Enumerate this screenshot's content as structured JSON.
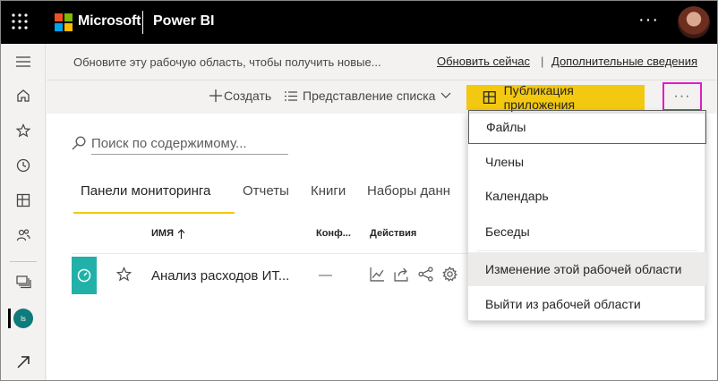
{
  "topbar": {
    "brand": "Microsoft",
    "product": "Power BI",
    "more": "···"
  },
  "notice": {
    "text": "Обновите эту рабочую область, чтобы получить новые...",
    "update_link": "Обновить сейчас",
    "separator": "|",
    "more_link": "Дополнительные сведения"
  },
  "toolbar": {
    "create": "Создать",
    "view": "Представление списка",
    "publish": "Публикация приложения",
    "more": "···"
  },
  "search": {
    "placeholder": "Поиск по содержимому..."
  },
  "tabs": [
    "Панели мониторинга",
    "Отчеты",
    "Книги",
    "Наборы данн"
  ],
  "table": {
    "headers": {
      "name": "ИМЯ",
      "conf": "Конф...",
      "actions": "Действия"
    },
    "rows": [
      {
        "name": "Анализ расходов ИТ...",
        "conf": "—"
      }
    ]
  },
  "workspace": {
    "initials": "ls"
  },
  "menu": {
    "items": [
      "Файлы",
      "Члены",
      "Календарь",
      "Беседы",
      "Изменение этой рабочей области",
      "Выйти из рабочей области"
    ]
  },
  "colors": {
    "accent": "#f2c811",
    "highlight": "#e11bc9",
    "teal": "#22b1a8"
  }
}
